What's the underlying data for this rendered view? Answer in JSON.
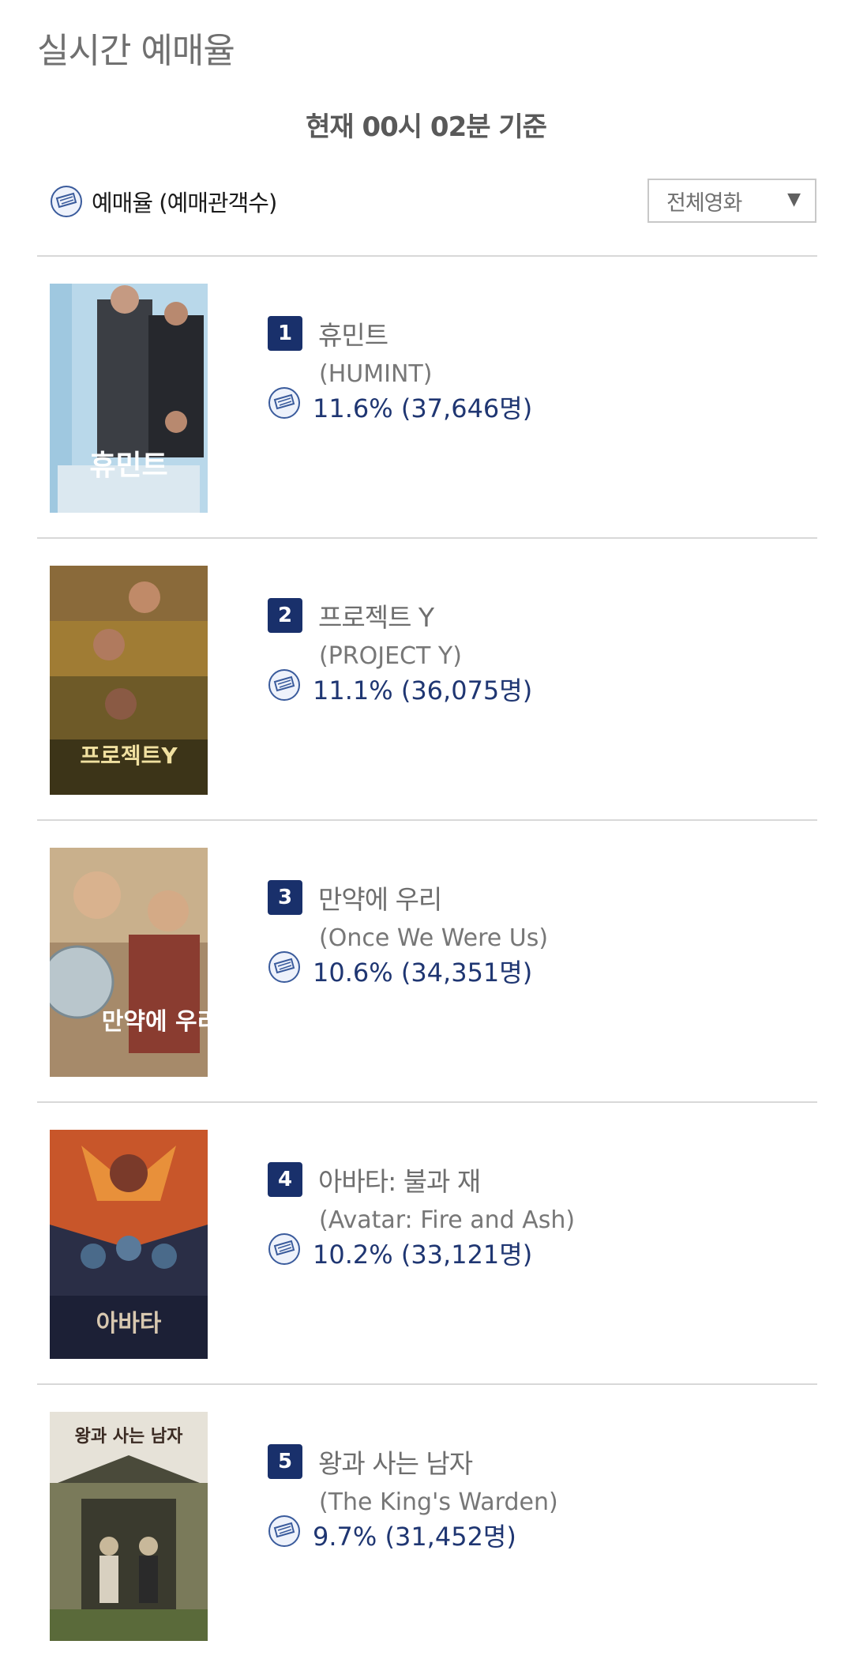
{
  "page_title": "실시간 예매율",
  "timestamp": "현재 00시 02분 기준",
  "legend": {
    "label": "예매율 (예매관객수)"
  },
  "filter": {
    "selected": "전체영화"
  },
  "colors": {
    "accent": "#19306b",
    "rate_text": "#1f3672",
    "divider": "#d8d8d8"
  },
  "movies": [
    {
      "rank": "1",
      "title_ko": "휴민트",
      "title_en": "(HUMINT)",
      "rate": "11.6% (37,646명)",
      "poster_text": "휴민트"
    },
    {
      "rank": "2",
      "title_ko": "프로젝트 Y",
      "title_en": "(PROJECT Y)",
      "rate": "11.1% (36,075명)",
      "poster_text": "프로젝트Y"
    },
    {
      "rank": "3",
      "title_ko": "만약에 우리",
      "title_en": "(Once We Were Us)",
      "rate": "10.6% (34,351명)",
      "poster_text": "만약에 우리"
    },
    {
      "rank": "4",
      "title_ko": "아바타: 불과 재",
      "title_en": "(Avatar: Fire and Ash)",
      "rate": "10.2% (33,121명)",
      "poster_text": "아바타"
    },
    {
      "rank": "5",
      "title_ko": "왕과 사는 남자",
      "title_en": "(The King's Warden)",
      "rate": "9.7% (31,452명)",
      "poster_text": "왕과 사는 남자"
    }
  ]
}
